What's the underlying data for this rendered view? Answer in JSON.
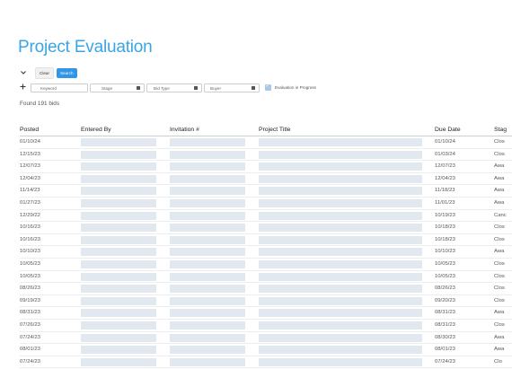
{
  "page_title": "Project Evaluation",
  "toolbar": {
    "chevron_icon": "chevron-down-icon",
    "clear_label": "Clear",
    "search_label": "Search"
  },
  "filters": {
    "add_icon": "plus-icon",
    "keyword_placeholder": "Keyword",
    "stage_placeholder": "Stage",
    "bid_type_placeholder": "Bid Type",
    "buyer_placeholder": "Buyer",
    "evaluation_checkbox_label": "Evaluation in Progress",
    "evaluation_checked": true
  },
  "results": {
    "found_text": "Found 191 bids"
  },
  "table": {
    "columns": {
      "posted": "Posted",
      "entered_by": "Entered By",
      "invitation": "Invitation #",
      "project_title": "Project Title",
      "due_date": "Due Date",
      "stage": "Stag"
    },
    "rows": [
      {
        "posted": "01/10/24",
        "due_date": "01/10/24",
        "stage": "Clos"
      },
      {
        "posted": "12/15/23",
        "due_date": "01/03/24",
        "stage": "Clos"
      },
      {
        "posted": "12/07/23",
        "due_date": "12/07/23",
        "stage": "Awa"
      },
      {
        "posted": "12/04/23",
        "due_date": "12/04/23",
        "stage": "Awa"
      },
      {
        "posted": "11/14/23",
        "due_date": "11/18/23",
        "stage": "Awa"
      },
      {
        "posted": "01/27/23",
        "due_date": "11/01/23",
        "stage": "Awa"
      },
      {
        "posted": "12/29/22",
        "due_date": "10/19/23",
        "stage": "Canc"
      },
      {
        "posted": "10/16/23",
        "due_date": "10/18/23",
        "stage": "Clos"
      },
      {
        "posted": "10/16/23",
        "due_date": "10/18/23",
        "stage": "Clos"
      },
      {
        "posted": "10/10/23",
        "due_date": "10/10/23",
        "stage": "Awa"
      },
      {
        "posted": "10/05/23",
        "due_date": "10/05/23",
        "stage": "Clos"
      },
      {
        "posted": "10/05/23",
        "due_date": "10/05/23",
        "stage": "Clos"
      },
      {
        "posted": "08/26/23",
        "due_date": "08/26/23",
        "stage": "Clos"
      },
      {
        "posted": "09/19/23",
        "due_date": "09/20/23",
        "stage": "Clos"
      },
      {
        "posted": "08/31/23",
        "due_date": "08/31/23",
        "stage": "Awa"
      },
      {
        "posted": "07/26/23",
        "due_date": "08/31/23",
        "stage": "Clos"
      },
      {
        "posted": "07/24/23",
        "due_date": "08/30/23",
        "stage": "Awa"
      },
      {
        "posted": "08/01/23",
        "due_date": "08/01/23",
        "stage": "Awa"
      },
      {
        "posted": "07/24/23",
        "due_date": "07/24/23",
        "stage": "Clo"
      }
    ]
  }
}
